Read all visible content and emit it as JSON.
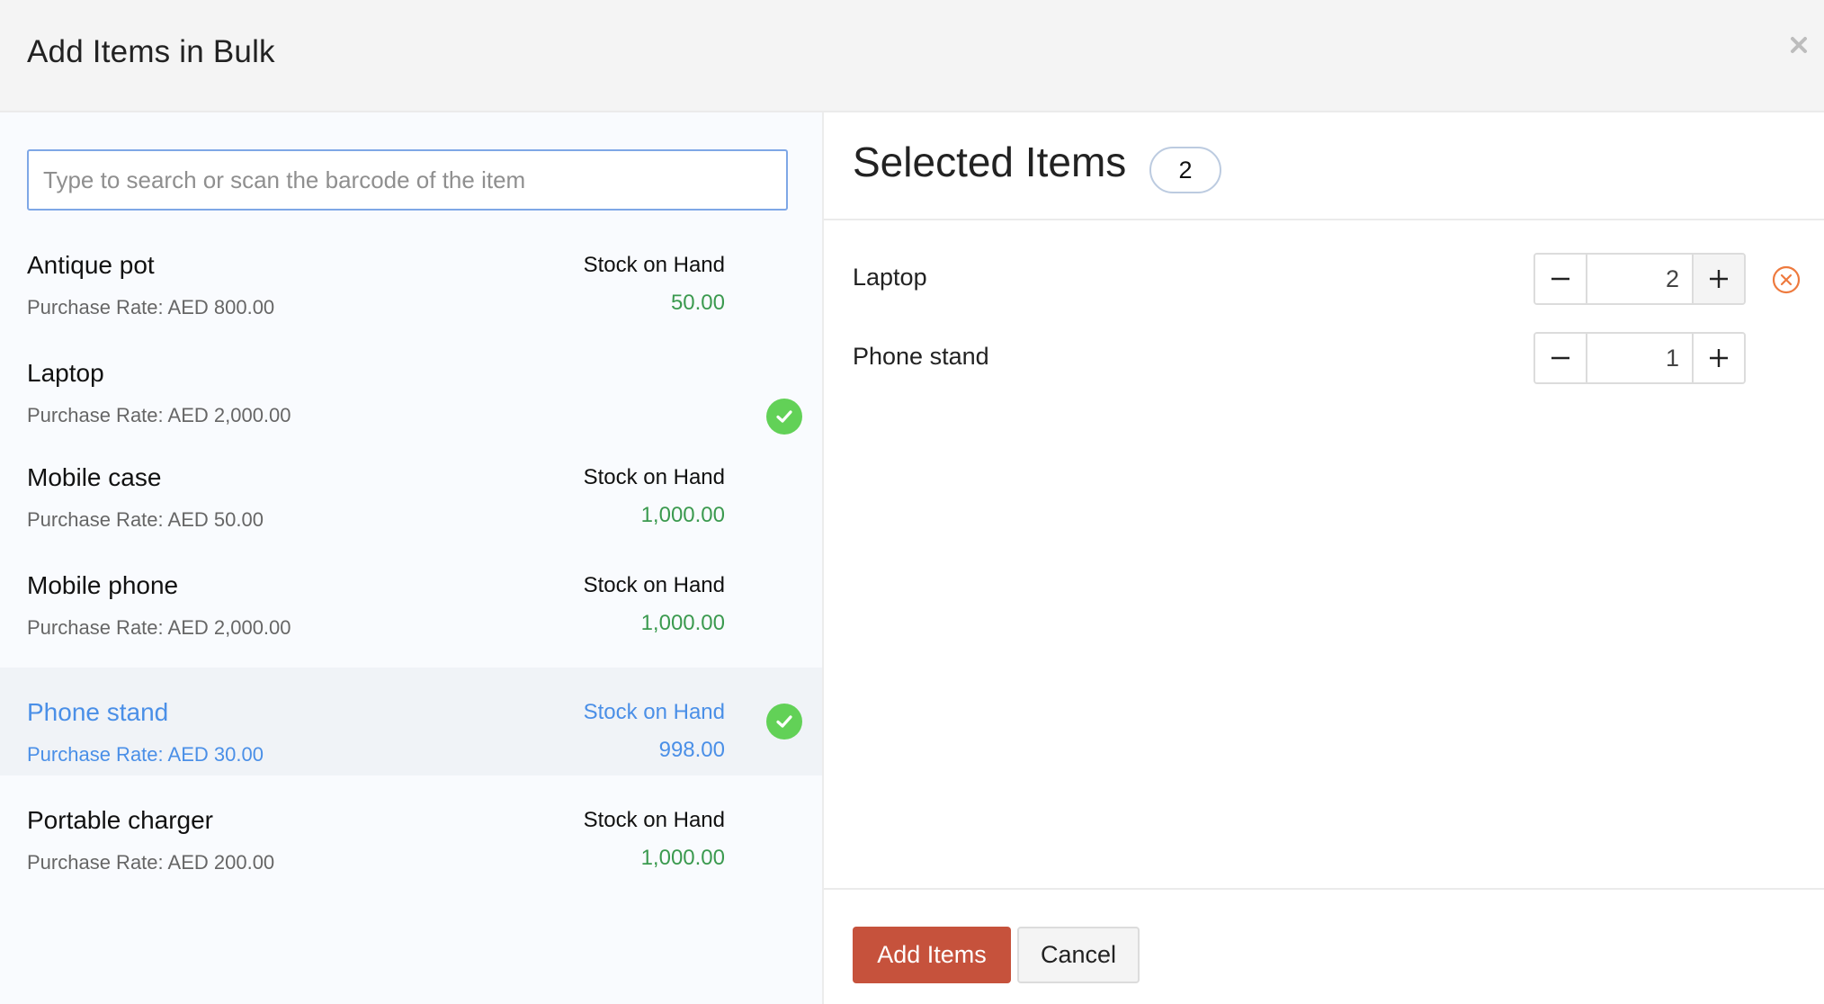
{
  "modal": {
    "title": "Add Items in Bulk",
    "close_icon": "close-icon"
  },
  "search": {
    "placeholder": "Type to search or scan the barcode of the item",
    "value": ""
  },
  "items": [
    {
      "name": "Antique pot",
      "rate": "Purchase Rate: AED 800.00",
      "stock_label": "Stock on Hand",
      "stock_value": "50.00",
      "selected": false,
      "highlighted": false
    },
    {
      "name": "Laptop",
      "rate": "Purchase Rate: AED 2,000.00",
      "stock_label": "",
      "stock_value": "",
      "selected": true,
      "highlighted": false
    },
    {
      "name": "Mobile case",
      "rate": "Purchase Rate: AED 50.00",
      "stock_label": "Stock on Hand",
      "stock_value": "1,000.00",
      "selected": false,
      "highlighted": false
    },
    {
      "name": "Mobile phone",
      "rate": "Purchase Rate: AED 2,000.00",
      "stock_label": "Stock on Hand",
      "stock_value": "1,000.00",
      "selected": false,
      "highlighted": false
    },
    {
      "name": "Phone stand",
      "rate": "Purchase Rate: AED 30.00",
      "stock_label": "Stock on Hand",
      "stock_value": "998.00",
      "selected": true,
      "highlighted": true
    },
    {
      "name": "Portable charger",
      "rate": "Purchase Rate: AED 200.00",
      "stock_label": "Stock on Hand",
      "stock_value": "1,000.00",
      "selected": false,
      "highlighted": false
    }
  ],
  "selected_panel": {
    "title": "Selected Items",
    "count": "2",
    "rows": [
      {
        "name": "Laptop",
        "quantity": "2",
        "show_remove": true
      },
      {
        "name": "Phone stand",
        "quantity": "1",
        "show_remove": false
      }
    ]
  },
  "footer": {
    "add_label": "Add Items",
    "cancel_label": "Cancel"
  },
  "colors": {
    "primary_button": "#c6523c",
    "stock_green": "#3b9a4f",
    "highlight_blue": "#4a8fe7",
    "check_green": "#62d157",
    "remove_orange": "#ee7a3e"
  }
}
